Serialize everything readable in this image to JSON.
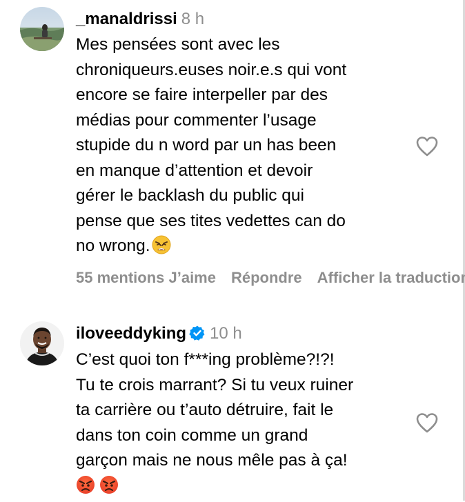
{
  "comments": [
    {
      "username": "_manaldrissi",
      "time": "8 h",
      "verified": false,
      "avatar_icon": "landscape-photo-avatar",
      "lines": [
        "Mes pensées sont avec les",
        "chroniqueurs.euses noir.e.s qui vont",
        "encore se faire interpeller par des",
        "médias pour commenter l’usage",
        "stupide du n word par un has been",
        "en manque d’attention et devoir",
        "gérer le backlash du public qui",
        "pense que ses tites vedettes can do",
        "no wrong."
      ],
      "emoji": [
        "weary-face-emoji"
      ],
      "likes": "55 mentions J’aime",
      "reply": "Répondre",
      "translate": "Afficher la traduction"
    },
    {
      "username": "iloveeddyking",
      "time": "10 h",
      "verified": true,
      "avatar_icon": "man-portrait-avatar",
      "lines": [
        "C’est quoi ton f***ing problème?!?!",
        "Tu te crois marrant? Si tu veux ruiner",
        "ta carrière ou t’auto détruire, fait le",
        "dans ton coin comme un grand",
        "garçon mais ne nous mêle pas à ça!"
      ],
      "emoji": [
        "pouting-face-emoji",
        "pouting-face-emoji"
      ]
    }
  ],
  "colors": {
    "text": "#000000",
    "muted": "#8e8e8e",
    "verified_blue": "#0095f6",
    "border": "#dbdbdb"
  }
}
